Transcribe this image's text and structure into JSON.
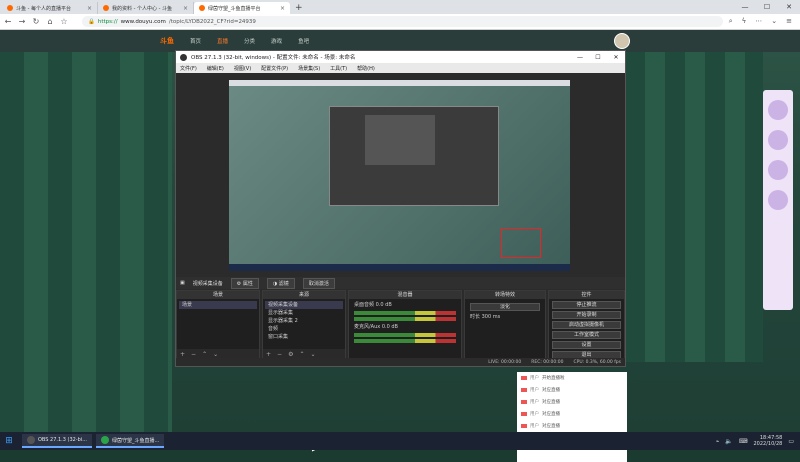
{
  "browser": {
    "tabs": [
      {
        "title": "斗鱼 - 每个人的直播平台",
        "active": false
      },
      {
        "title": "我的资料 - 个人中心 - 斗鱼",
        "active": false
      },
      {
        "title": "绿茵守望_斗鱼直播平台",
        "active": true
      }
    ],
    "address": {
      "secure_prefix": "https://",
      "host": "www.douyu.com",
      "path": "/topic/LYDB2022_CF?rid=24939"
    }
  },
  "site": {
    "logo": "斗鱼",
    "nav": [
      "首页",
      "直播",
      "分类",
      "游戏",
      "鱼吧"
    ],
    "active_nav": "直播"
  },
  "obs": {
    "title": "OBS 27.1.3 (32-bit, windows) - 配置文件: 未命名 - 场景: 未命名",
    "menu": [
      "文件(F)",
      "编辑(E)",
      "视图(V)",
      "配置文件(P)",
      "场景集(S)",
      "工具(T)",
      "帮助(H)"
    ],
    "source_bar": {
      "label": "视频采集设备",
      "props": "属性",
      "filters": "滤镜",
      "cancel": "取消激活"
    },
    "docks": {
      "scenes": {
        "title": "场景",
        "items": [
          "场景"
        ]
      },
      "sources": {
        "title": "来源",
        "items": [
          "视频采集设备",
          "显示器采集",
          "显示器采集 2",
          "音频",
          "窗口采集"
        ]
      },
      "mixer": {
        "title": "混音器",
        "channels": [
          {
            "name": "桌面音频",
            "db": "0.0 dB"
          },
          {
            "name": "麦克风/Aux",
            "db": "0.0 dB"
          }
        ]
      },
      "transitions": {
        "title": "转场特效",
        "type": "淡化",
        "duration_label": "时长",
        "duration": "300 ms"
      },
      "controls": {
        "title": "控件",
        "buttons": [
          "停止推流",
          "开始录制",
          "启动虚拟摄像机",
          "工作室模式",
          "设置",
          "退出"
        ]
      }
    },
    "status": {
      "live": "LIVE: 00:00:00",
      "rec": "REC: 00:00:00",
      "cpu": "CPU: 0.3%, 60.00 fps"
    }
  },
  "chat": {
    "messages": [
      {
        "user": "用户",
        "text": "开始直播啦"
      },
      {
        "user": "用户",
        "text": "对应直播"
      },
      {
        "user": "用户",
        "text": "对应直播"
      },
      {
        "user": "用户",
        "text": "对应直播"
      },
      {
        "user": "用户",
        "text": "对应直播"
      }
    ]
  },
  "taskbar": {
    "items": [
      {
        "label": "OBS 27.1.3 (32-bi...",
        "icon": "obs-icon"
      },
      {
        "label": "绿茵守望_斗鱼直播...",
        "icon": "browser-icon"
      }
    ],
    "time": "18:47:58",
    "date": "2022/10/28"
  }
}
